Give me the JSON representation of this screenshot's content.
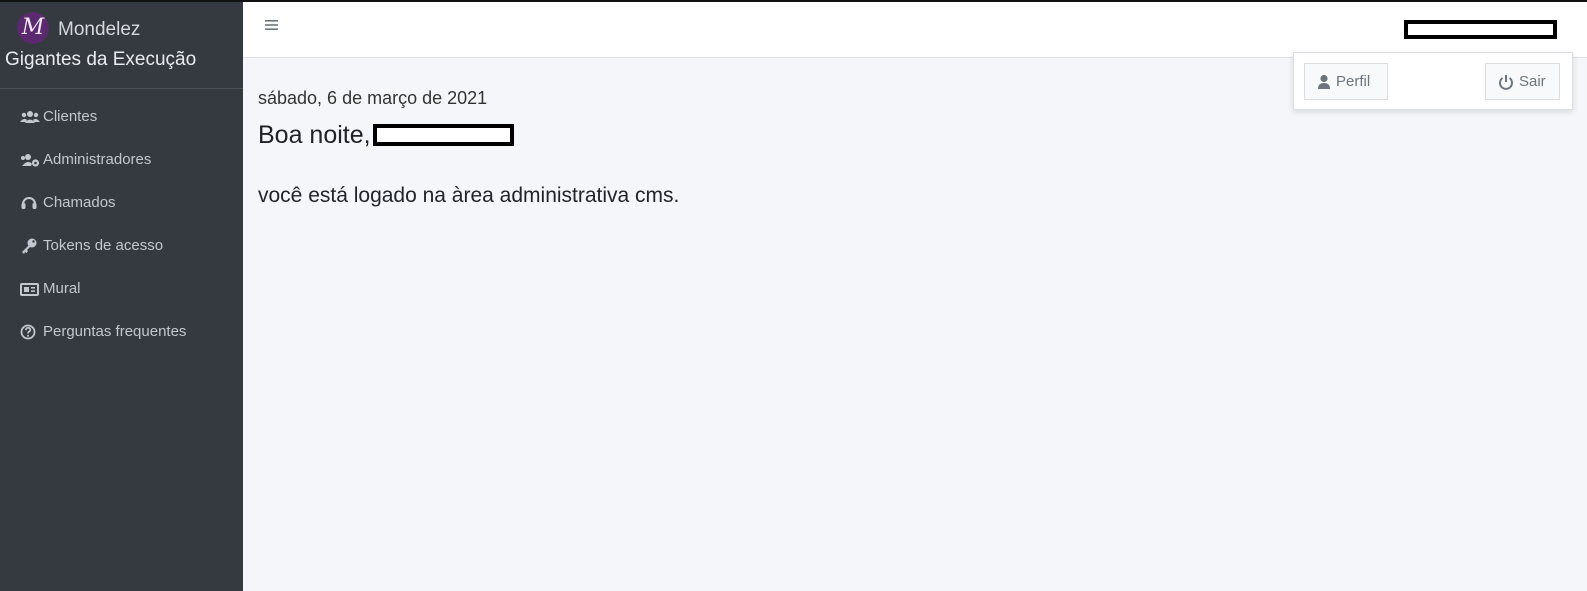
{
  "brand": {
    "logo_letter": "M",
    "name": "Mondelez",
    "subtitle": "Gigantes da Execução"
  },
  "sidebar": {
    "items": [
      {
        "label": "Clientes",
        "icon": "users-icon"
      },
      {
        "label": "Administradores",
        "icon": "users-cog-icon"
      },
      {
        "label": "Chamados",
        "icon": "headset-icon"
      },
      {
        "label": "Tokens de acesso",
        "icon": "key-icon"
      },
      {
        "label": "Mural",
        "icon": "newspaper-icon"
      },
      {
        "label": "Perguntas frequentes",
        "icon": "question-circle-icon"
      }
    ]
  },
  "header": {
    "menu_icon": "hamburger-icon",
    "user_name": ""
  },
  "dropdown": {
    "profile_label": "Perfil",
    "exit_label": "Sair"
  },
  "main": {
    "date": "sábado, 6 de março de 2021",
    "greeting": "Boa noite,",
    "message": "você está logado na àrea administrativa cms."
  },
  "colors": {
    "sidebar_bg": "#343a40",
    "page_bg": "#f4f6f9",
    "logo_bg": "#5b2a6e"
  }
}
